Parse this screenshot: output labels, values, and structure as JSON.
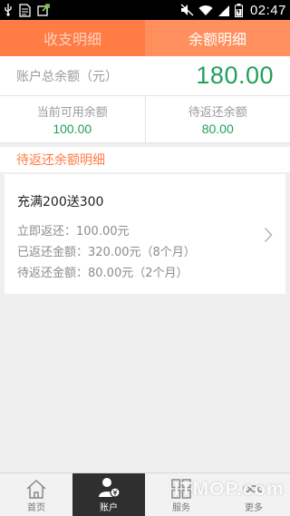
{
  "status_bar": {
    "time": "02:47"
  },
  "tabs": [
    {
      "label": "收支明细",
      "active": false
    },
    {
      "label": "余额明细",
      "active": true
    }
  ],
  "summary": {
    "label": "账户总余额（元）",
    "value": "180.00"
  },
  "balances": {
    "available_label": "当前可用余额",
    "available_value": "100.00",
    "pending_label": "待返还余额",
    "pending_value": "80.00"
  },
  "section": {
    "title": "待返还余额明细"
  },
  "promo_card": {
    "title": "充满200送300",
    "line1": "立即返还：100.00元",
    "line2": "已返还金额：320.00元（8个月）",
    "line3": "待返还金额：80.00元（2个月）"
  },
  "bottom_nav": [
    {
      "label": "首页",
      "icon": "home-icon"
    },
    {
      "label": "账户",
      "icon": "account-icon"
    },
    {
      "label": "服务",
      "icon": "services-grid-icon"
    },
    {
      "label": "更多",
      "icon": "more-icon"
    }
  ],
  "watermark": "ITMOP.com",
  "colors": {
    "accent": "#ff7c45",
    "money_green": "#21a05b",
    "muted_text": "#9a9a9a"
  }
}
